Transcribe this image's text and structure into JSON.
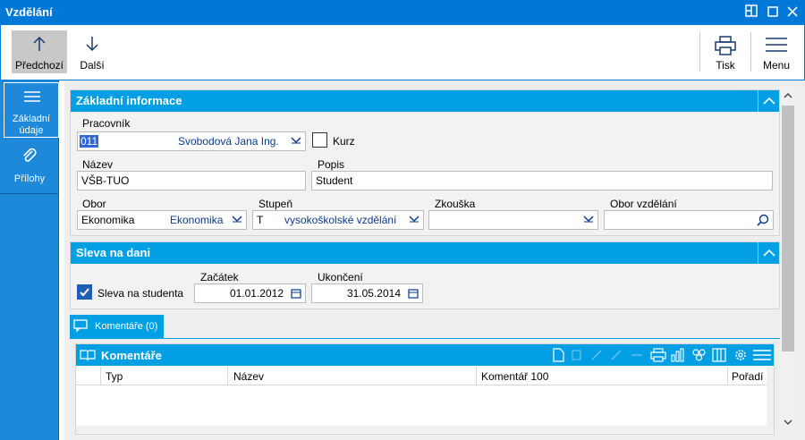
{
  "window": {
    "title": "Vzdělání"
  },
  "toolbar": {
    "prev_label": "Předchozí",
    "next_label": "Další",
    "print_label": "Tisk",
    "menu_label": "Menu"
  },
  "nav": {
    "items": [
      {
        "label_line1": "Základní",
        "label_line2": "údaje"
      },
      {
        "label_line1": "Přílohy"
      }
    ]
  },
  "basic": {
    "title": "Základní informace",
    "pracovnik_label": "Pracovník",
    "pracovnik_code": "011",
    "pracovnik_name": "Svobodová Jana Ing.",
    "kurz_label": "Kurz",
    "nazev_label": "Název",
    "nazev_value": "VŠB-TUO",
    "popis_label": "Popis",
    "popis_value": "Student",
    "obor_label": "Obor",
    "obor_code": "Ekonomika",
    "obor_name": "Ekonomika",
    "stupen_label": "Stupeň",
    "stupen_code": "T",
    "stupen_name": "vysokoškolské vzdělání",
    "zkouska_label": "Zkouška",
    "zkouska_value": "",
    "obor_vzdelani_label": "Obor vzdělání",
    "obor_vzdelani_value": ""
  },
  "tax": {
    "title": "Sleva na dani",
    "student_label": "Sleva na studenta",
    "student_checked": true,
    "zacatek_label": "Začátek",
    "zacatek_value": "01.01.2012",
    "ukonceni_label": "Ukončení",
    "ukonceni_value": "31.05.2014"
  },
  "comments": {
    "tab_label": "Komentáře (0)",
    "grid_title": "Komentáře",
    "columns": [
      "Typ",
      "Název",
      "Komentář 100",
      "Pořadí"
    ]
  },
  "colors": {
    "accent": "#009fe3",
    "titlebar": "#0078d7",
    "nav": "#1e88d9"
  }
}
